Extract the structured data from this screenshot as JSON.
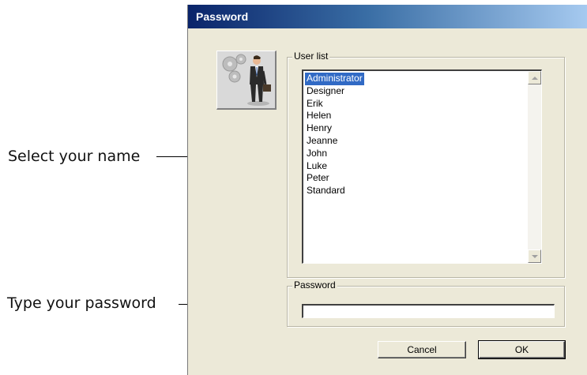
{
  "callouts": {
    "select_name": "Select your name",
    "type_password": "Type your password"
  },
  "window": {
    "title": "Password"
  },
  "user_list": {
    "group_label": "User list",
    "items": [
      "Administrator",
      "Designer",
      "Erik",
      "Helen",
      "Henry",
      "Jeanne",
      "John",
      "Luke",
      "Peter",
      "Standard"
    ],
    "selected": "Administrator"
  },
  "password": {
    "group_label": "Password",
    "value": ""
  },
  "buttons": {
    "cancel": "Cancel",
    "ok": "OK"
  },
  "icons": {
    "user_image": "businessman-with-gears-icon"
  },
  "colors": {
    "title_gradient_start": "#0a246a",
    "title_gradient_end": "#a6caf0",
    "selection": "#316ac5",
    "dialog_face": "#ece9d8"
  }
}
